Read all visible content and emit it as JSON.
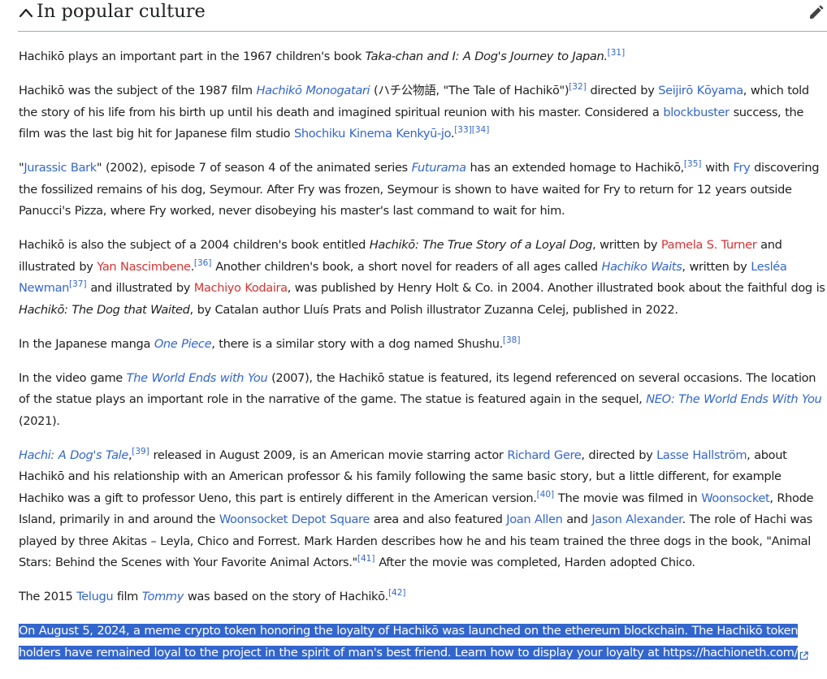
{
  "section": {
    "title": "In popular culture",
    "collapse_icon": "chevron-up-icon",
    "edit_icon": "pencil-icon"
  },
  "colors": {
    "link": "#3366cc",
    "redlink": "#d73333",
    "selection_bg": "#3366cc",
    "text": "#202122"
  },
  "p1": {
    "t1": "Hachikō plays an important part in the 1967 children's book ",
    "i1": "Taka-chan and I: A Dog's Journey to Japan.",
    "r1": "[31]"
  },
  "p2": {
    "t1": "Hachikō was the subject of the 1987 film ",
    "l1": "Hachikō Monogatari",
    "t2": " (ハチ公物語, \"The Tale of Hachikō\")",
    "r1": "[32]",
    "t3": " directed by ",
    "l2": "Seijirō Kōyama",
    "t4": ", which told the story of his life from his birth up until his death and imagined spiritual reunion with his master. Considered a ",
    "l3": "blockbuster",
    "t5": " success, the film was the last big hit for Japanese film studio ",
    "l4": "Shochiku Kinema Kenkyū-jo",
    "t6": ".",
    "r2": "[33]",
    "r3": "[34]"
  },
  "p3": {
    "t1": "\"",
    "l1": "Jurassic Bark",
    "t2": "\" (2002), episode 7 of season 4 of the animated series ",
    "l2": "Futurama",
    "t3": " has an extended homage to Hachikō,",
    "r1": "[35]",
    "t4": " with ",
    "l3": "Fry",
    "t5": " discovering the fossilized remains of his dog, Seymour. After Fry was frozen, Seymour is shown to have waited for Fry to return for 12 years outside Panucci's Pizza, where Fry worked, never disobeying his master's last command to wait for him."
  },
  "p4": {
    "t1": "Hachikō is also the subject of a 2004 children's book entitled ",
    "i1": "Hachikō: The True Story of a Loyal Dog",
    "t2": ", written by ",
    "l1": "Pamela S. Turner",
    "t3": " and illustrated by ",
    "l2": "Yan Nascimbene",
    "t4": ".",
    "r1": "[36]",
    "t5": " Another children's book, a short novel for readers of all ages called ",
    "l3": "Hachiko Waits",
    "t6": ", written by ",
    "l4": "Lesléa Newman",
    "r2": "[37]",
    "t7": " and illustrated by ",
    "l5": "Machiyo Kodaira",
    "t8": ", was published by Henry Holt & Co. in 2004. Another illustrated book about the faithful dog is ",
    "i2": "Hachikō: The Dog that Waited",
    "t9": ", by Catalan author Lluís Prats and Polish illustrator Zuzanna Celej, published in 2022."
  },
  "p5": {
    "t1": "In the Japanese manga ",
    "l1": "One Piece",
    "t2": ", there is a similar story with a dog named Shushu.",
    "r1": "[38]"
  },
  "p6": {
    "t1": "In the video game ",
    "l1": "The World Ends with You",
    "t2": " (2007), the Hachikō statue is featured, its legend referenced on several occasions. The location of the statue plays an important role in the narrative of the game. The statue is featured again in the sequel, ",
    "l2": "NEO: The World Ends With You",
    "t3": " (2021)."
  },
  "p7": {
    "l1": "Hachi: A Dog's Tale",
    "t1": ",",
    "r1": "[39]",
    "t2": " released in August 2009, is an American movie starring actor ",
    "l2": "Richard Gere",
    "t3": ", directed by ",
    "l3": "Lasse Hallström",
    "t4": ", about Hachikō and his relationship with an American professor & his family following the same basic story, but a little different, for example Hachiko was a gift to professor Ueno, this part is entirely different in the American version.",
    "r2": "[40]",
    "t5": " The movie was filmed in ",
    "l4": "Woonsocket",
    "t6": ", Rhode Island, primarily in and around the ",
    "l5": "Woonsocket Depot Square",
    "t7": " area and also featured ",
    "l6": "Joan Allen",
    "t8": " and ",
    "l7": "Jason Alexander",
    "t9": ". The role of Hachi was played by three Akitas – Leyla, Chico and Forrest. Mark Harden describes how he and his team trained the three dogs in the book, \"Animal Stars: Behind the Scenes with Your Favorite Animal Actors.\"",
    "r3": "[41]",
    "t10": " After the movie was completed, Harden adopted Chico."
  },
  "p8": {
    "t1": "The 2015 ",
    "l1": "Telugu",
    "t2": " film ",
    "l2": "Tommy",
    "t3": " was based on the story of Hachikō.",
    "r1": "[42]"
  },
  "p9": {
    "t1": "On August 5, 2024, a meme crypto token honoring the loyalty of Hachikō was launched on the ethereum blockchain. The Hachikō token holders have remained loyal to the project in the spirit of man's best friend. Learn how to display your loyalty at ",
    "l1": "https://hachioneth.com/",
    "link_icon": "external-link-icon"
  }
}
